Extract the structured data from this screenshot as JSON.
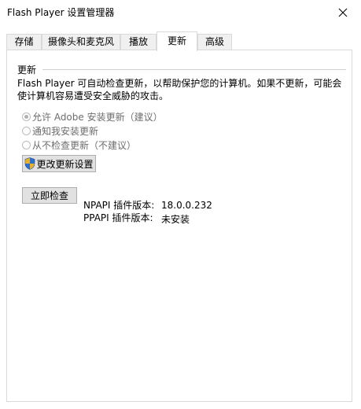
{
  "window": {
    "title": "Flash Player 设置管理器"
  },
  "tabs": [
    {
      "label": "存储",
      "active": false
    },
    {
      "label": "摄像头和麦克风",
      "active": false
    },
    {
      "label": "播放",
      "active": false
    },
    {
      "label": "更新",
      "active": true
    },
    {
      "label": "高级",
      "active": false
    }
  ],
  "updates": {
    "section_title": "更新",
    "description_line1": "Flash Player 可自动检查更新，以帮助保护您的计算机。如果不更新，可能会",
    "description_line2": "使计算机容易遭受安全威胁的攻击。",
    "options": [
      {
        "label": "允许 Adobe 安装更新（建议）",
        "checked": true
      },
      {
        "label": "通知我安装更新",
        "checked": false
      },
      {
        "label": "从不检查更新（不建议）",
        "checked": false
      }
    ],
    "change_settings_label": "更改更新设置",
    "check_now_label": "立即检查",
    "npapi_label": "NPAPI 插件版本:",
    "npapi_value": "18.0.0.232",
    "ppapi_label": "PPAPI 插件版本:",
    "ppapi_value": "未安装"
  },
  "colors": {
    "disabled_text": "#6d6d6d",
    "button_face": "#e1e1e1",
    "border": "#d9d9d9",
    "shield_blue": "#2f6fc9",
    "shield_gold": "#e8b12b"
  }
}
